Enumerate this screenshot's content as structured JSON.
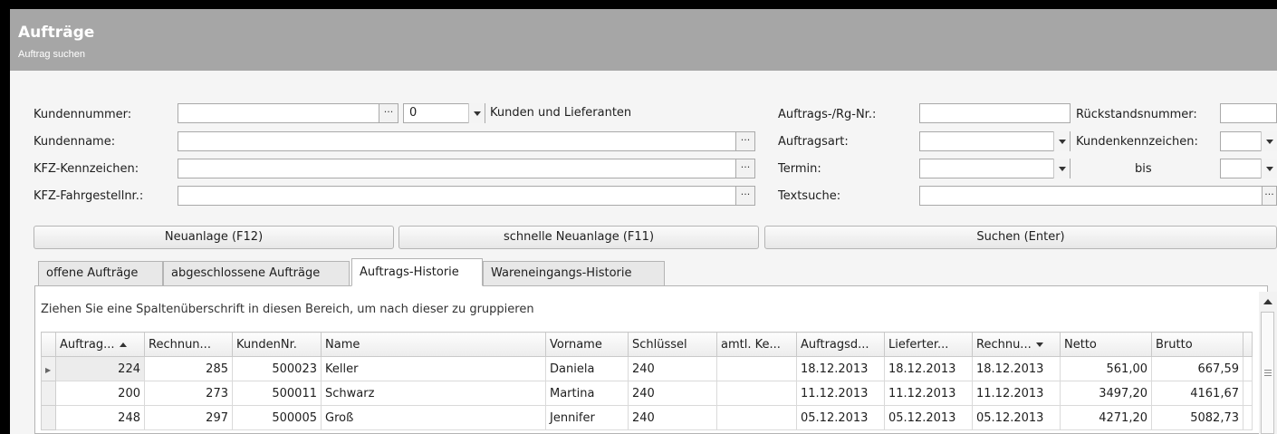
{
  "header": {
    "title": "Aufträge",
    "subtitle": "Auftrag suchen"
  },
  "form": {
    "kundennummer_label": "Kundennummer:",
    "kundennummer_value": "",
    "kundentyp_value": "0",
    "kundentyp_text": "Kunden und Lieferanten",
    "kundenname_label": "Kundenname:",
    "kfz_kennzeichen_label": "KFZ-Kennzeichen:",
    "kfz_fahrgestell_label": "KFZ-Fahrgestellnr.:",
    "auftragsnr_label": "Auftrags-/Rg-Nr.:",
    "auftragsart_label": "Auftragsart:",
    "termin_label": "Termin:",
    "bis_label": "bis",
    "textsuche_label": "Textsuche:",
    "rueckstand_label": "Rückstandsnummer:",
    "kundenkennzeichen_label": "Kundenkennzeichen:",
    "ellipsis": "···"
  },
  "buttons": {
    "neuanlage": "Neuanlage (F12)",
    "schnelle_neuanlage": "schnelle Neuanlage (F11)",
    "suchen": "Suchen (Enter)"
  },
  "tabs": [
    {
      "label": "offene Aufträge",
      "active": false
    },
    {
      "label": "abgeschlossene Aufträge",
      "active": false
    },
    {
      "label": "Auftrags-Historie",
      "active": true
    },
    {
      "label": "Wareneingangs-Historie",
      "active": false
    }
  ],
  "grid": {
    "group_hint": "Ziehen Sie eine Spaltenüberschrift in diesen Bereich, um nach dieser zu gruppieren",
    "columns": [
      "Auftrag...",
      "Rechnun...",
      "KundenNr.",
      "Name",
      "Vorname",
      "Schlüssel",
      "amtl. Ke...",
      "Auftragsd...",
      "Lieferter...",
      "Rechnu...",
      "Netto",
      "Brutto"
    ],
    "rows": [
      [
        "224",
        "285",
        "500023",
        "Keller",
        "Daniela",
        "240",
        "",
        "18.12.2013",
        "18.12.2013",
        "18.12.2013",
        "561,00",
        "667,59"
      ],
      [
        "200",
        "273",
        "500011",
        "Schwarz",
        "Martina",
        "240",
        "",
        "11.12.2013",
        "11.12.2013",
        "11.12.2013",
        "3497,20",
        "4161,67"
      ],
      [
        "248",
        "297",
        "500005",
        "Groß",
        "Jennifer",
        "240",
        "",
        "05.12.2013",
        "05.12.2013",
        "05.12.2013",
        "4271,20",
        "5082,73"
      ]
    ]
  }
}
